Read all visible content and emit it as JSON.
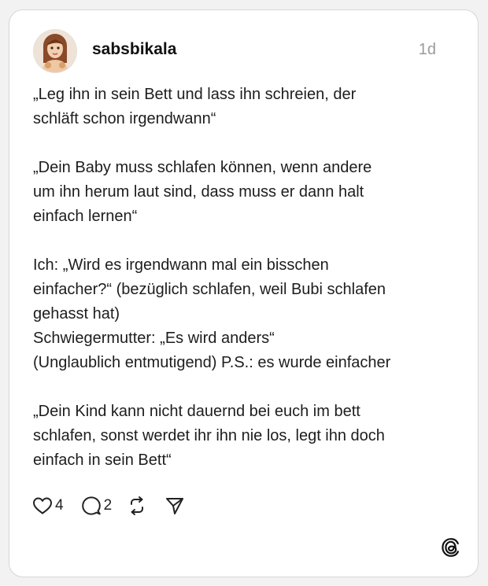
{
  "post": {
    "username": "sabsbikala",
    "timestamp": "1d",
    "paragraphs": [
      [
        "„Leg ihn in sein Bett und lass ihn schreien, der",
        "schläft schon irgendwann“"
      ],
      [
        "„Dein Baby muss schlafen können, wenn andere",
        "um ihn herum laut sind, dass muss er dann halt",
        "einfach lernen“"
      ],
      [
        "Ich: „Wird es irgendwann mal ein bisschen",
        "einfacher?“ (bezüglich schlafen, weil Bubi schlafen",
        "gehasst hat)",
        "Schwiegermutter: „Es wird anders“",
        "(Unglaublich entmutigend) P.S.: es wurde einfacher"
      ],
      [
        "„Dein Kind kann nicht dauernd bei euch im bett",
        "schlafen, sonst werdet ihr ihn nie los, legt ihn doch",
        "einfach in sein Bett“"
      ]
    ],
    "actions": {
      "like_count": "4",
      "comment_count": "2"
    }
  },
  "icons": {
    "like": "heart-icon",
    "comment": "comment-bubble-icon",
    "repost": "repost-icon",
    "share": "send-icon",
    "brand": "threads-logo-icon"
  },
  "colors": {
    "background": "#f2f2f2",
    "card": "#ffffff",
    "text": "#1d1d1d",
    "timestamp": "#9a9a9a"
  }
}
